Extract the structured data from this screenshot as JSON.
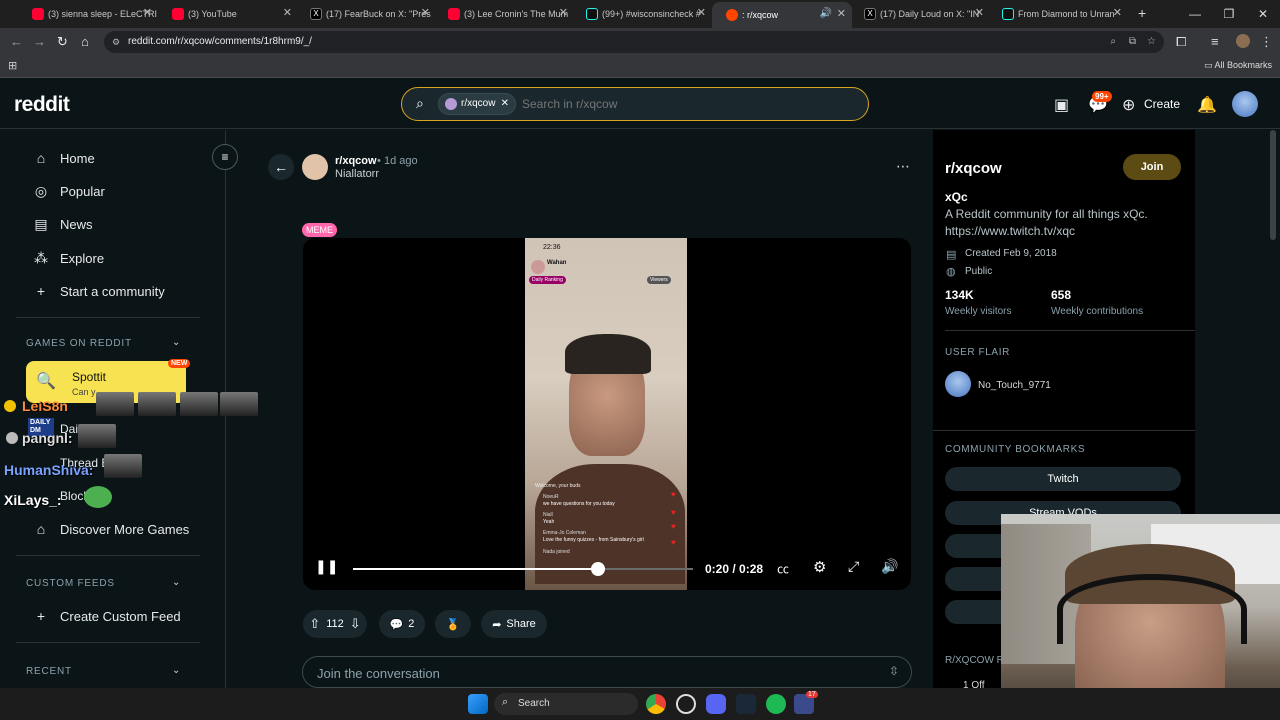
{
  "browser": {
    "tabs": [
      {
        "label": "(3) sienna sleep - ELeCTRI",
        "icon": "youtube-icon"
      },
      {
        "label": "(3) YouTube",
        "icon": "youtube-icon"
      },
      {
        "label": "(17) FearBuck on X: \"Pres",
        "icon": "x-icon"
      },
      {
        "label": "(3) Lee Cronin's The Mum",
        "icon": "youtube-icon"
      },
      {
        "label": "(99+) #wisconsincheck #",
        "icon": "tiktok-icon"
      },
      {
        "label": ": r/xqcow",
        "icon": "reddit-icon"
      },
      {
        "label": "(17) Daily Loud on X: \"IN",
        "icon": "x-icon"
      },
      {
        "label": "From Diamond to Unran",
        "icon": "tiktok-icon"
      }
    ],
    "url": "reddit.com/r/xqcow/comments/1r8hrm9/_/",
    "bookmarks_label": "All Bookmarks"
  },
  "header": {
    "logo": "reddit",
    "search_chip": "r/xqcow",
    "search_placeholder": "Search in r/xqcow",
    "notif_badge": "99+",
    "create_label": "Create"
  },
  "leftnav": {
    "items": [
      "Home",
      "Popular",
      "News",
      "Explore",
      "Start a community"
    ],
    "games_heading": "GAMES ON REDDIT",
    "spottit_label": "Spottit",
    "spottit_sub": "Can y",
    "new_badge": "NEW",
    "daily_label": "Dail",
    "thread_label": "Thread B",
    "blocks_label": "Block",
    "discover_label": "Discover More Games",
    "custom_heading": "CUSTOM FEEDS",
    "create_feed": "Create Custom Feed",
    "recent_heading": "RECENT"
  },
  "chat_overlay": {
    "names": [
      "LeiS8n",
      "pangnl:",
      "HumanShiva:",
      "XiLays_:"
    ],
    "daily_badge": "DAILY DM"
  },
  "post": {
    "subreddit": "r/xqcow",
    "time": "1d ago",
    "author": "Niallatorr",
    "flair": "MEME",
    "time_display": "0:20 / 0:28",
    "progress": 0.72,
    "votes": "112",
    "comments": "2",
    "share_label": "Share",
    "comment_placeholder": "Join the conversation",
    "phone_clock": "22:36",
    "phone_user": "Wahan",
    "phone_daily": "Daily Ranking",
    "phone_viewers": "Viewers",
    "phone_chat": [
      {
        "name": "NoeuR",
        "text": "we have questions for you today"
      },
      {
        "name": "Niall",
        "text": "Yeah"
      },
      {
        "name": "Emma-Jo Coleman",
        "text": "Love the funny quizzes - from Sainsbury's girl"
      },
      {
        "name": "Nada joined",
        "text": ""
      }
    ],
    "phone_welcome": "Welcome, your buds"
  },
  "rightbar": {
    "title": "r/xqcow",
    "join_label": "Join",
    "name": "xQc",
    "description": "A Reddit community for all things xQc. https://www.twitch.tv/xqc",
    "created": "Created Feb 9, 2018",
    "visibility": "Public",
    "visitors_value": "134K",
    "visitors_label": "Weekly visitors",
    "contrib_value": "658",
    "contrib_label": "Weekly contributions",
    "user_flair_heading": "USER FLAIR",
    "user_flair_name": "No_Touch_9771",
    "bookmarks_heading": "COMMUNITY BOOKMARKS",
    "bookmarks": [
      "Twitch",
      "Stream VODs"
    ],
    "rules_heading": "R/XQCOW R",
    "rules_first": "1   Off"
  },
  "taskbar": {
    "search_label": "Search",
    "notif_badge": "17"
  },
  "colors": {
    "accent_orange": "#ff4500",
    "search_border": "#d9a521",
    "join_bg": "#5c4b12",
    "flair_pink": "#ff66ac"
  }
}
